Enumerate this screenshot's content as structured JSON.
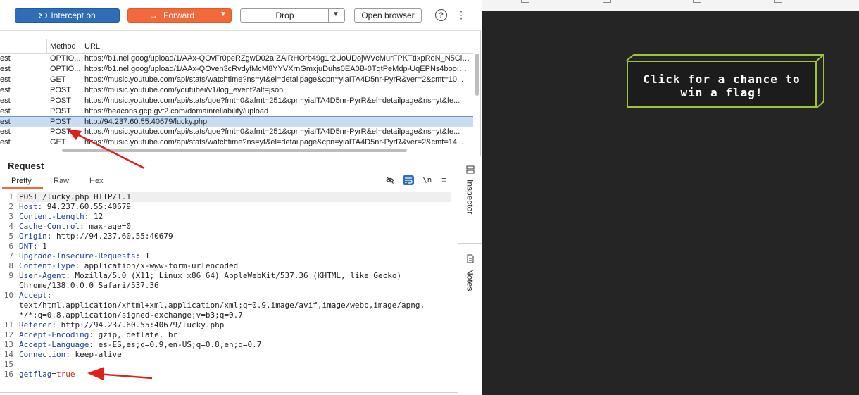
{
  "toolbar": {
    "intercept_label": "Intercept on",
    "forward_label": "Forward",
    "drop_label": "Drop",
    "open_browser_label": "Open browser",
    "help_symbol": "?",
    "more_symbol": "⋮",
    "accent_color": "#f26a3c",
    "intercept_color": "#2f6db6"
  },
  "history": {
    "headers": [
      "",
      "Method",
      "URL"
    ],
    "rows": [
      {
        "type": "est",
        "method": "OPTIO...",
        "url": "https://b1.nel.goog/upload/1/AAx-QOvFr0peRZgwD02aIZAlRHOrb49g1r2UoUDojWVcMurFPKTtIxpRoN_N5Clb..."
      },
      {
        "type": "est",
        "method": "OPTIO...",
        "url": "https://b1.nel.goog/upload/1/AAx-QOven3cRvdyfMcM8YYVXrnGmxjuDuhs0EA0B-0TqtPeMdp-UqEPNs4booISh..."
      },
      {
        "type": "est",
        "method": "GET",
        "url": "https://music.youtube.com/api/stats/watchtime?ns=yt&el=detailpage&cpn=yiaITA4D5nr-PyrR&ver=2&cmt=10..."
      },
      {
        "type": "est",
        "method": "POST",
        "url": "https://music.youtube.com/youtubei/v1/log_event?alt=json"
      },
      {
        "type": "est",
        "method": "POST",
        "url": "https://music.youtube.com/api/stats/qoe?fmt=0&afmt=251&cpn=yiaITA4D5nr-PyrR&el=detailpage&ns=yt&fe..."
      },
      {
        "type": "est",
        "method": "POST",
        "url": "https://beacons.gcp.gvt2.com/domainreliability/upload"
      },
      {
        "type": "est",
        "method": "POST",
        "url": "http://94.237.60.55:40679/lucky.php"
      },
      {
        "type": "est",
        "method": "POST",
        "url": "https://music.youtube.com/api/stats/qoe?fmt=0&afmt=251&cpn=yiaITA4D5nr-PyrR&el=detailpage&ns=yt&fe..."
      },
      {
        "type": "est",
        "method": "GET",
        "url": "https://music.youtube.com/api/stats/watchtime?ns=yt&el=detailpage&cpn=yiaITA4D5nr-PyrR&ver=2&cmt=14..."
      }
    ],
    "selected_index": 6
  },
  "request": {
    "title": "Request",
    "tabs": [
      "Pretty",
      "Raw",
      "Hex"
    ],
    "active_tab": "Pretty",
    "newline_symbol": "\\n",
    "lines": [
      {
        "n": "1",
        "key": "",
        "value": "POST /lucky.php HTTP/1.1"
      },
      {
        "n": "2",
        "key": "Host",
        "value": "94.237.60.55:40679"
      },
      {
        "n": "3",
        "key": "Content-Length",
        "value": "12"
      },
      {
        "n": "4",
        "key": "Cache-Control",
        "value": "max-age=0"
      },
      {
        "n": "5",
        "key": "Origin",
        "value": "http://94.237.60.55:40679"
      },
      {
        "n": "6",
        "key": "DNT",
        "value": "1"
      },
      {
        "n": "7",
        "key": "Upgrade-Insecure-Requests",
        "value": "1"
      },
      {
        "n": "8",
        "key": "Content-Type",
        "value": "application/x-www-form-urlencoded"
      },
      {
        "n": "9",
        "key": "User-Agent",
        "value": "Mozilla/5.0 (X11; Linux x86_64) AppleWebKit/537.36 (KHTML, like Gecko)",
        "cont": [
          "Chrome/138.0.0.0 Safari/537.36"
        ]
      },
      {
        "n": "10",
        "key": "Accept",
        "value": "",
        "cont": [
          "text/html,application/xhtml+xml,application/xml;q=0.9,image/avif,image/webp,image/apng,",
          "*/*;q=0.8,application/signed-exchange;v=b3;q=0.7"
        ]
      },
      {
        "n": "11",
        "key": "Referer",
        "value": "http://94.237.60.55:40679/lucky.php"
      },
      {
        "n": "12",
        "key": "Accept-Encoding",
        "value": "gzip, deflate, br"
      },
      {
        "n": "13",
        "key": "Accept-Language",
        "value": "es-ES,es;q=0.9,en-US;q=0.8,en;q=0.7"
      },
      {
        "n": "14",
        "key": "Connection",
        "value": "keep-alive"
      },
      {
        "n": "15",
        "key": "",
        "value": ""
      },
      {
        "n": "16",
        "key": "getflag",
        "value": "true",
        "body": true
      }
    ]
  },
  "side_tabs": {
    "inspector_label": "Inspector",
    "notes_label": "Notes"
  },
  "game": {
    "button_line1": "Click for a chance to",
    "button_line2": "win a flag!",
    "border_color": "#9ac43c"
  },
  "annotation_color": "#e0201c"
}
